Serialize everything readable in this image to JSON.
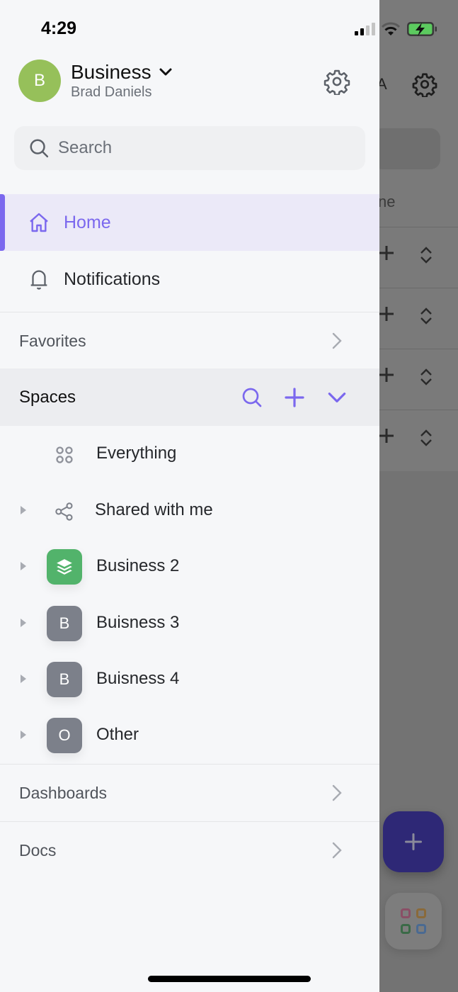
{
  "status_bar": {
    "time": "4:29",
    "icons": [
      "signal-icon",
      "wifi-icon",
      "battery-charging-icon"
    ]
  },
  "workspace": {
    "avatar_initial": "B",
    "name": "Business",
    "user": "Brad Daniels",
    "avatar_color": "#96c05a"
  },
  "search": {
    "placeholder": "Search"
  },
  "nav": {
    "items": [
      {
        "label": "Home",
        "icon": "home-icon",
        "active": true
      },
      {
        "label": "Notifications",
        "icon": "bell-icon",
        "active": false
      }
    ]
  },
  "sections": {
    "favorites": "Favorites",
    "spaces": "Spaces",
    "dashboards": "Dashboards",
    "docs": "Docs"
  },
  "spaces": {
    "items": [
      {
        "label": "Everything",
        "icon": "grid-dots-icon"
      },
      {
        "label": "Shared with me",
        "icon": "share-icon"
      },
      {
        "label": "Business 2",
        "icon": "layers-icon",
        "color": "#52b36b"
      },
      {
        "label": "Buisness 3",
        "initial": "B",
        "color": "#7c808a"
      },
      {
        "label": "Buisness 4",
        "initial": "B",
        "color": "#7c808a"
      },
      {
        "label": "Other",
        "initial": "O",
        "color": "#7c808a"
      }
    ]
  },
  "background": {
    "tab_fragment": "ne"
  },
  "colors": {
    "accent": "#7b68ee",
    "fab": "#2e2876"
  }
}
